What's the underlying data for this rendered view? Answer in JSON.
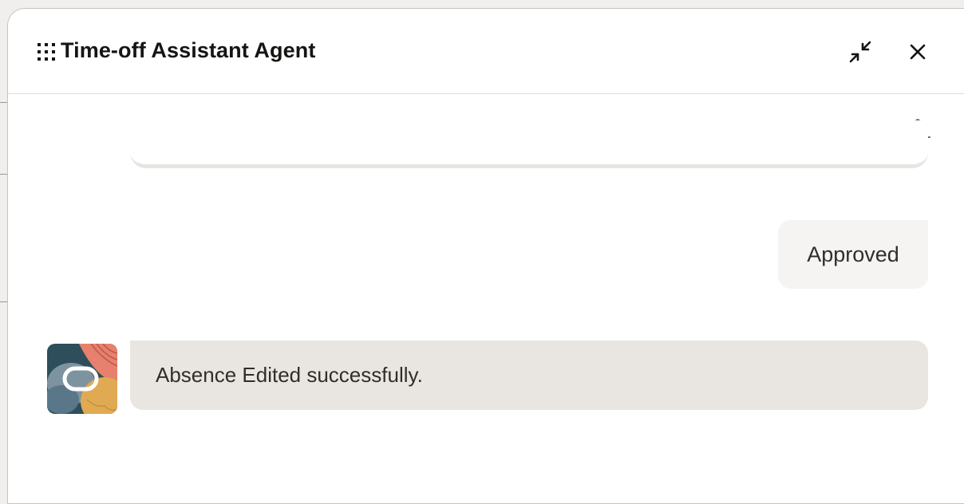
{
  "window": {
    "title": "Time-off Assistant Agent"
  },
  "header": {
    "menu_icon": "grid-icon",
    "collapse_icon": "collapse-icon",
    "close_icon": "close-icon"
  },
  "toolbar": {
    "stack_icon": "layers-add-icon"
  },
  "conversation": {
    "user_message": "Approved",
    "agent_message": "Absence Edited successfully.",
    "agent_avatar_icon": "oracle-logo-icon"
  },
  "colors": {
    "title_text": "#161513",
    "user_bubble": "#f5f4f2",
    "agent_bubble": "#e9e5e1",
    "message_text": "#312d2a"
  }
}
